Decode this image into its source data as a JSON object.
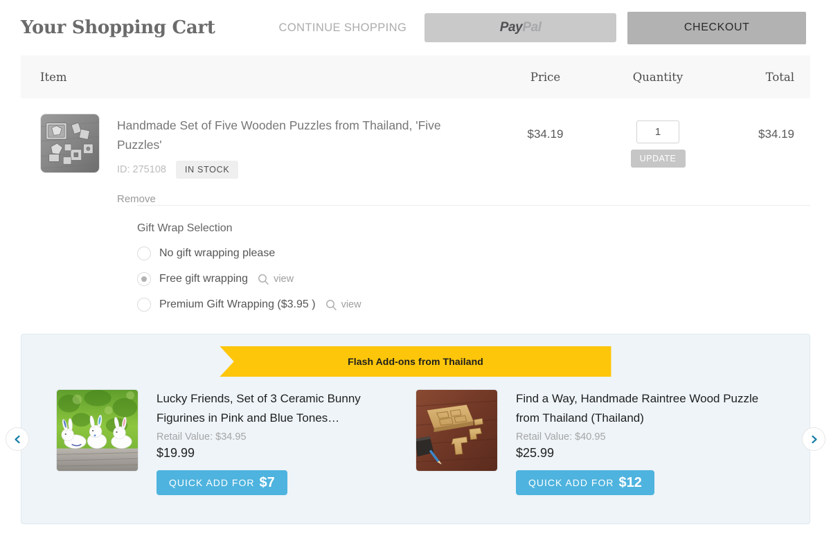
{
  "header": {
    "title": "Your Shopping Cart",
    "continue_shopping": "CONTINUE SHOPPING",
    "paypal_part1": "Pay",
    "paypal_part2": "Pal",
    "checkout": "CHECKOUT"
  },
  "table": {
    "columns": {
      "item": "Item",
      "price": "Price",
      "quantity": "Quantity",
      "total": "Total"
    }
  },
  "cart_item": {
    "name": "Handmade Set of Five Wooden Puzzles from Thailand, 'Five Puzzles'",
    "id": "ID: 275108",
    "stock": "IN STOCK",
    "remove": "Remove",
    "price": "$34.19",
    "quantity": "1",
    "update": "UPDATE",
    "total": "$34.19",
    "image_alt": "wooden-puzzle-pieces-grayscale"
  },
  "gift_wrap": {
    "title": "Gift Wrap Selection",
    "options": [
      {
        "label": "No gift wrapping please",
        "selected": false,
        "has_view": false,
        "view": ""
      },
      {
        "label": "Free gift wrapping",
        "selected": true,
        "has_view": true,
        "view": "view"
      },
      {
        "label": "Premium Gift Wrapping ($3.95 )",
        "selected": false,
        "has_view": true,
        "view": "view"
      }
    ]
  },
  "addons": {
    "ribbon": "Flash Add-ons from Thailand",
    "items": [
      {
        "title": "Lucky Friends, Set of 3 Ceramic Bunny Figurines in Pink and Blue Tones…",
        "retail": "Retail Value: $34.95",
        "price": "$19.99",
        "cta_label": "QUICK ADD FOR",
        "cta_amount": "$7",
        "image_alt": "ceramic-bunny-figurines"
      },
      {
        "title": "Find a Way, Handmade Raintree Wood Puzzle from Thailand (Thailand)",
        "retail": "Retail Value: $40.95",
        "price": "$25.99",
        "cta_label": "QUICK ADD FOR",
        "cta_amount": "$12",
        "image_alt": "raintree-wood-puzzle"
      }
    ],
    "prev_icon": "chevron-left-icon",
    "next_icon": "chevron-right-icon"
  },
  "colors": {
    "accent_blue": "#4eb3de",
    "ribbon_yellow": "#fdc60b",
    "panel_bg": "#eef4f8",
    "checkout_gray": "#b2b2b2"
  }
}
